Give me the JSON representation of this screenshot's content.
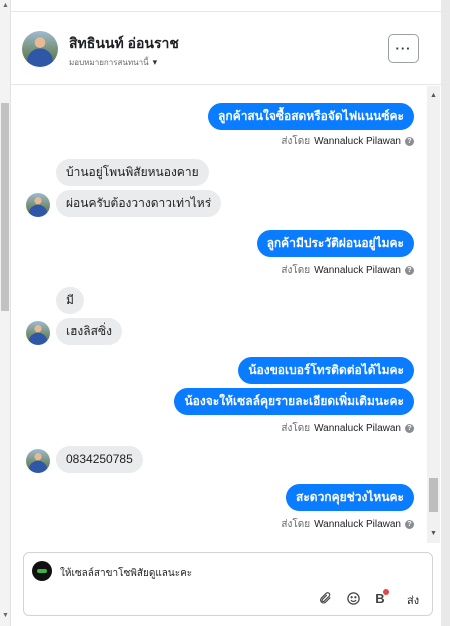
{
  "header": {
    "contact_name": "สิทธินนท์ อ่อนราช",
    "assign_label": "มอบหมายการสนทนานี้"
  },
  "messages": [
    {
      "id": "m1",
      "direction": "out",
      "text": "ลูกค้าสนใจซื้อสดหรือจัดไฟแนนซ์คะ"
    },
    {
      "id": "s1",
      "type": "sent_by",
      "prefix": "ส่งโดย",
      "agent": "Wannaluck Pilawan"
    },
    {
      "id": "m2",
      "direction": "in",
      "text": "บ้านอยู่โพนพิสัยหนองคาย"
    },
    {
      "id": "m3",
      "direction": "in",
      "text": "ผ่อนครับต้องวางดาวเท่าไหร่"
    },
    {
      "id": "m4",
      "direction": "out",
      "text": "ลูกค้ามีประวัติผ่อนอยู่ไมคะ"
    },
    {
      "id": "s2",
      "type": "sent_by",
      "prefix": "ส่งโดย",
      "agent": "Wannaluck Pilawan"
    },
    {
      "id": "m5",
      "direction": "in",
      "text": "มี"
    },
    {
      "id": "m6",
      "direction": "in",
      "text": "เฮงลิสซิ่ง"
    },
    {
      "id": "m7",
      "direction": "out",
      "text": "น้องขอเบอร์โทรติดต่อได้ไมคะ"
    },
    {
      "id": "m8",
      "direction": "out",
      "text": "น้องจะให้เซลล์คุยรายละเอียดเพิ่มเติมนะคะ"
    },
    {
      "id": "s3",
      "type": "sent_by",
      "prefix": "ส่งโดย",
      "agent": "Wannaluck Pilawan"
    },
    {
      "id": "m9",
      "direction": "in",
      "text": "0834250785"
    },
    {
      "id": "m10",
      "direction": "out",
      "text": "สะดวกคุยช่วงไหนคะ"
    },
    {
      "id": "s4",
      "type": "sent_by",
      "prefix": "ส่งโดย",
      "agent": "Wannaluck Pilawan"
    }
  ],
  "composer": {
    "text": "ให้เซลล์สาขาโซพิสัยดูแลนะคะ",
    "send_label": "ส่ง",
    "tools": [
      "attachment-icon",
      "emoji-icon",
      "bold-b-icon"
    ]
  },
  "colors": {
    "outgoing_bubble": "#0a7cff",
    "incoming_bubble": "#eaebed",
    "notification_dot": "#e84545"
  }
}
